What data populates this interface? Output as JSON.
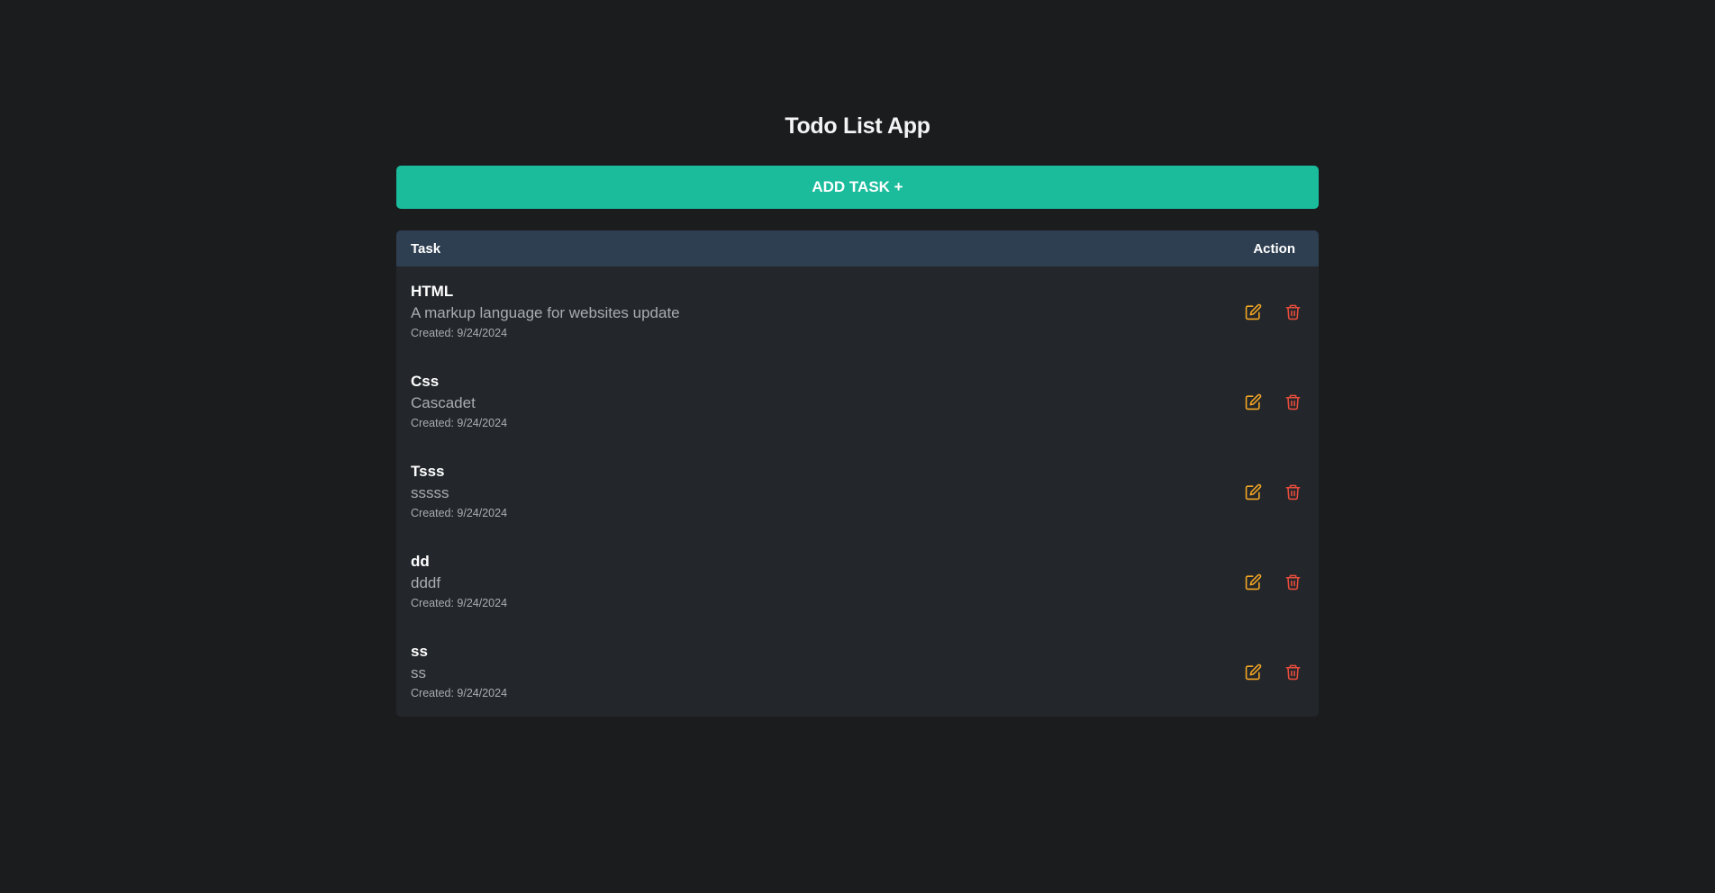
{
  "app": {
    "title": "Todo List App"
  },
  "add_button": {
    "label": "ADD TASK +"
  },
  "table": {
    "headers": {
      "task": "Task",
      "action": "Action"
    },
    "tasks": [
      {
        "title": "HTML",
        "description": "A markup language for websites update",
        "created": "Created: 9/24/2024"
      },
      {
        "title": "Css",
        "description": "Cascadet",
        "created": "Created: 9/24/2024"
      },
      {
        "title": "Tsss",
        "description": "sssss",
        "created": "Created: 9/24/2024"
      },
      {
        "title": "dd",
        "description": "dddf",
        "created": "Created: 9/24/2024"
      },
      {
        "title": "ss",
        "description": "ss",
        "created": "Created: 9/24/2024"
      }
    ]
  },
  "icons": {
    "edit": "edit-icon",
    "delete": "trash-icon"
  },
  "colors": {
    "background": "#1b1c1e",
    "accent": "#1abc9c",
    "header": "#2e3f52",
    "table": "#23272b",
    "edit": "#f5a623",
    "delete": "#e74c3c"
  }
}
